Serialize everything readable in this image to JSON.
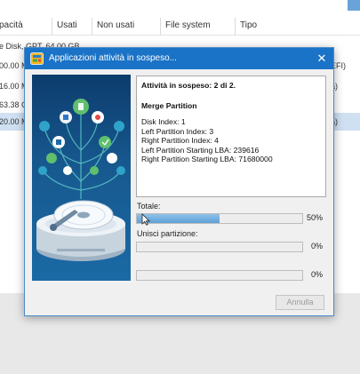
{
  "background": {
    "columns": [
      "pacità",
      "Usati",
      "Non usati",
      "File system",
      "Tipo"
    ],
    "rows": [
      {
        "cap": "e Disk, GPT, 64.00 GB",
        "right": ""
      },
      {
        "cap": "00.00 M",
        "right": "EFI)"
      },
      {
        "cap": "16.00 M",
        "right": "a)"
      },
      {
        "cap": "63.38 G",
        "right": ""
      },
      {
        "cap": "20.00 M",
        "right": "a)"
      }
    ]
  },
  "dialog": {
    "title": "Applicazioni attività in sospeso...",
    "close_label": "✕",
    "info": {
      "heading": "Attività in sospeso: 2 di 2.",
      "operation": "Merge Partition",
      "details": [
        "Disk Index: 1",
        "Left Partition Index: 3",
        "Right Partition Index: 4",
        "Left Partition Starting LBA: 239616",
        "Right Partition Starting LBA: 71680000"
      ]
    },
    "progress": [
      {
        "label": "Totale:",
        "percent_text": "50%",
        "value": 0.5
      },
      {
        "label": "Unisci partizione:",
        "percent_text": "0%",
        "value": 0
      },
      {
        "label": "",
        "percent_text": "0%",
        "value": 0
      }
    ],
    "cancel_label": "Annulla"
  },
  "colors": {
    "titlebar": "#1a73c6",
    "progress_fill": "#5d9fd6",
    "selected_row": "#cfe0f2"
  }
}
